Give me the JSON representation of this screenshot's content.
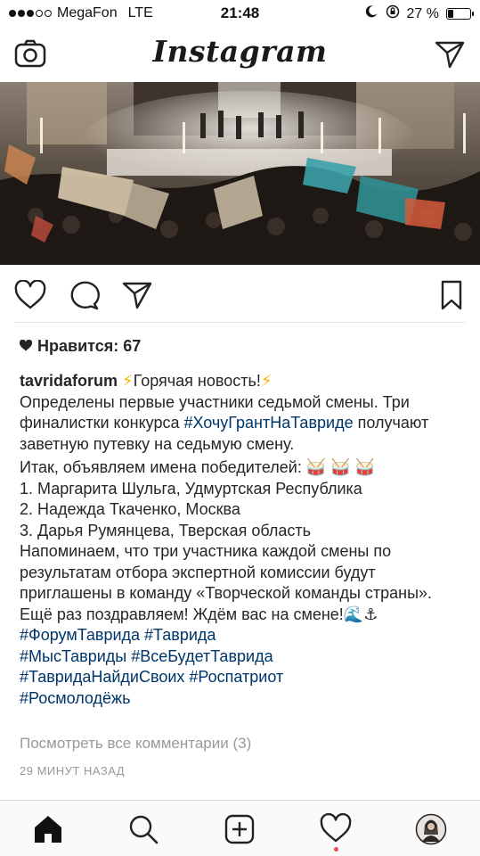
{
  "status": {
    "carrier": "MegaFon",
    "network": "LTE",
    "time": "21:48",
    "battery_text": "27 %",
    "battery_level": 0.27,
    "signal_bars_filled": 3,
    "signal_bars_total": 5
  },
  "header": {
    "brand": "Instagram",
    "left_icon": "camera-icon",
    "right_icon": "direct-send-icon"
  },
  "post": {
    "likes_label": "Нравится: 67",
    "username": "tavridaforum",
    "caption": {
      "line1_text": "Горячая новость!",
      "para1_a": "Определены первые участники седьмой смены. Три финалистки конкурса ",
      "para1_tag": "#ХочуГрантНаТавриде",
      "para1_b": " получают заветную путевку на седьмую смену.",
      "announce": "Итак, объявляем имена победителей:",
      "winners": [
        "1. Маргарита Шульга, Удмуртская Республика",
        "2. Надежда Ткаченко, Москва",
        "3. Дарья Румянцева, Тверская область"
      ],
      "reminder": "Напоминаем, что три участника каждой смены по результатам отбора экспертной комиссии будут приглашены в команду «Творческой команды страны». Ещё раз поздравляем! Ждём вас на смене!",
      "hashtags": [
        "#ФорумТаврида",
        "#Таврида",
        "#МысТавриды",
        "#ВсеБудетТаврида",
        "#ТавридаНайдиСвоих",
        "#Роспатриот",
        "#Росмолодёжь"
      ]
    },
    "view_comments": "Посмотреть все комментарии (3)",
    "time_ago": "29 МИНУТ НАЗАД"
  },
  "tabbar": {
    "items": [
      "home-icon",
      "search-icon",
      "add-post-icon",
      "activity-heart-icon",
      "profile-avatar"
    ]
  },
  "colors": {
    "hashtag": "#003569",
    "muted": "#999999",
    "notification": "#ed4956"
  }
}
